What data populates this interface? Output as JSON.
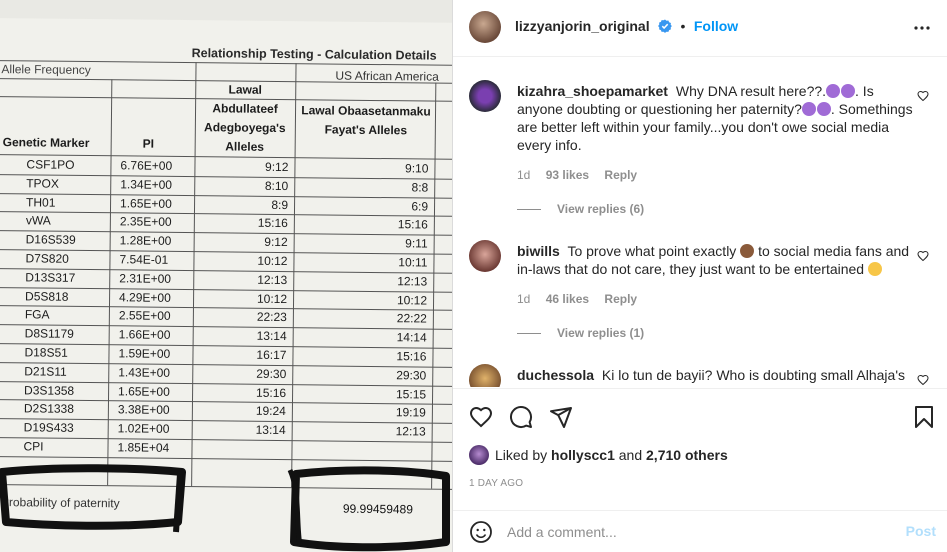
{
  "document": {
    "title": "Relationship Testing -  Calculation Details",
    "allele_frequency_label": "Allele Frequency",
    "population_label": "US African America",
    "headers": {
      "marker": "Genetic Marker",
      "pi": "PI",
      "child": "Lawal Abdullateef Adegboyega's Alleles",
      "father": "Lawal Obaasetanmaku Fayat's Alleles"
    },
    "rows": [
      {
        "marker": "CSF1PO",
        "pi": "6.76E+00",
        "child": "9:12",
        "father": "9:10"
      },
      {
        "marker": "TPOX",
        "pi": "1.34E+00",
        "child": "8:10",
        "father": "8:8"
      },
      {
        "marker": "TH01",
        "pi": "1.65E+00",
        "child": "8:9",
        "father": "6:9"
      },
      {
        "marker": "vWA",
        "pi": "2.35E+00",
        "child": "15:16",
        "father": "15:16"
      },
      {
        "marker": "D16S539",
        "pi": "1.28E+00",
        "child": "9:12",
        "father": "9:11"
      },
      {
        "marker": "D7S820",
        "pi": "7.54E-01",
        "child": "10:12",
        "father": "10:11"
      },
      {
        "marker": "D13S317",
        "pi": "2.31E+00",
        "child": "12:13",
        "father": "12:13"
      },
      {
        "marker": "D5S818",
        "pi": "4.29E+00",
        "child": "10:12",
        "father": "10:12"
      },
      {
        "marker": "FGA",
        "pi": "2.55E+00",
        "child": "22:23",
        "father": "22:22"
      },
      {
        "marker": "D8S1179",
        "pi": "1.66E+00",
        "child": "13:14",
        "father": "14:14"
      },
      {
        "marker": "D18S51",
        "pi": "1.59E+00",
        "child": "16:17",
        "father": "15:16"
      },
      {
        "marker": "D21S11",
        "pi": "1.43E+00",
        "child": "29:30",
        "father": "29:30"
      },
      {
        "marker": "D3S1358",
        "pi": "1.65E+00",
        "child": "15:16",
        "father": "15:15"
      },
      {
        "marker": "D2S1338",
        "pi": "3.38E+00",
        "child": "19:24",
        "father": "19:19"
      },
      {
        "marker": "D19S433",
        "pi": "1.02E+00",
        "child": "13:14",
        "father": "12:13"
      },
      {
        "marker": "CPI",
        "pi": "1.85E+04",
        "child": "",
        "father": ""
      }
    ],
    "probability_label": "Probability of paternity",
    "probability_value": "99.99459489"
  },
  "post": {
    "author": "lizzyanjorin_original",
    "verified": true,
    "separator": "•",
    "follow_label": "Follow"
  },
  "comments": [
    {
      "username": "kizahra_shoepamarket",
      "text_parts": [
        "Why DNA result here??.",
        ". Is anyone doubting or questioning her paternity?",
        ". Somethings are better left within your family...you don't owe social media every info."
      ],
      "time": "1d",
      "likes": "93 likes",
      "reply": "Reply",
      "view_replies": "View replies (6)"
    },
    {
      "username": "biwills",
      "text_parts": [
        "To prove what point exactly",
        "to social media fans and in-laws that do not care, they just want to be entertained"
      ],
      "time": "1d",
      "likes": "46 likes",
      "reply": "Reply",
      "view_replies": "View replies (1)"
    },
    {
      "username": "duchessola",
      "text_parts": [
        "Ki lo tun de bayii? Who is doubting small Alhaja's"
      ]
    }
  ],
  "likes": {
    "prefix": "Liked by",
    "user": "hollyscc1",
    "middle": "and",
    "others": "2,710 others"
  },
  "time_ago": "1 DAY AGO",
  "add_comment": {
    "placeholder": "Add a comment...",
    "post_label": "Post"
  },
  "colors": {
    "accent": "#0095f6",
    "post_disabled": "#b2dffc",
    "muted": "#8e8e8e"
  }
}
